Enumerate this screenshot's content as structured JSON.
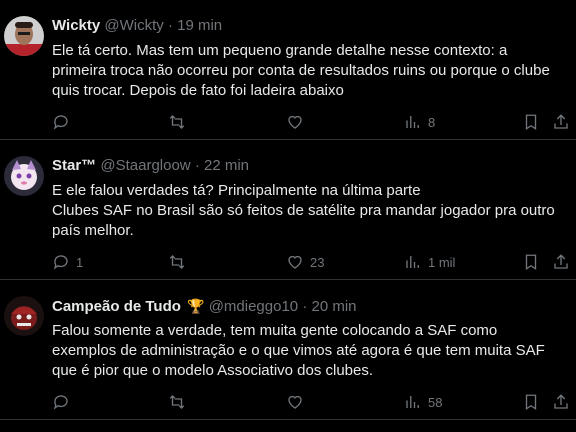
{
  "tweets": [
    {
      "name": "Wickty",
      "badge": "",
      "handle": "@Wickty",
      "separator": "·",
      "time": "19 min",
      "lines": [
        "Ele tá certo. Mas tem um pequeno grande detalhe nesse contexto: a",
        "primeira troca não ocorreu por conta de resultados ruins ou porque o clube",
        "quis trocar. Depois de fato foi ladeira abaixo"
      ],
      "replies": "",
      "retweets": "",
      "likes": "",
      "views": "8"
    },
    {
      "name": "Star™",
      "badge": "",
      "handle": "@Staargloow",
      "separator": "·",
      "time": "22 min",
      "lines": [
        "E ele falou verdades tá? Principalmente na última parte",
        "Clubes SAF no Brasil são só feitos de satélite pra mandar jogador pra outro",
        "país melhor."
      ],
      "replies": "1",
      "retweets": "",
      "likes": "23",
      "views": "1 mil"
    },
    {
      "name": "Campeão de Tudo",
      "badge": "🏆",
      "handle": "@mdieggo10",
      "separator": "·",
      "time": "20 min",
      "lines": [
        "Falou somente a verdade, tem muita gente colocando a SAF como",
        "exemplos de administração e o que vimos até agora é que tem muita SAF",
        "que é pior que o modelo Associativo dos clubes."
      ],
      "replies": "",
      "retweets": "",
      "likes": "",
      "views": "58"
    }
  ],
  "icons": {
    "reply": "reply-icon",
    "retweet": "retweet-icon",
    "like": "heart-icon",
    "views": "views-icon",
    "bookmark": "bookmark-icon",
    "share": "share-icon"
  },
  "colors": {
    "background": "#000000",
    "text": "#e7e9ea",
    "muted": "#71767b",
    "divider": "#2f3336"
  }
}
